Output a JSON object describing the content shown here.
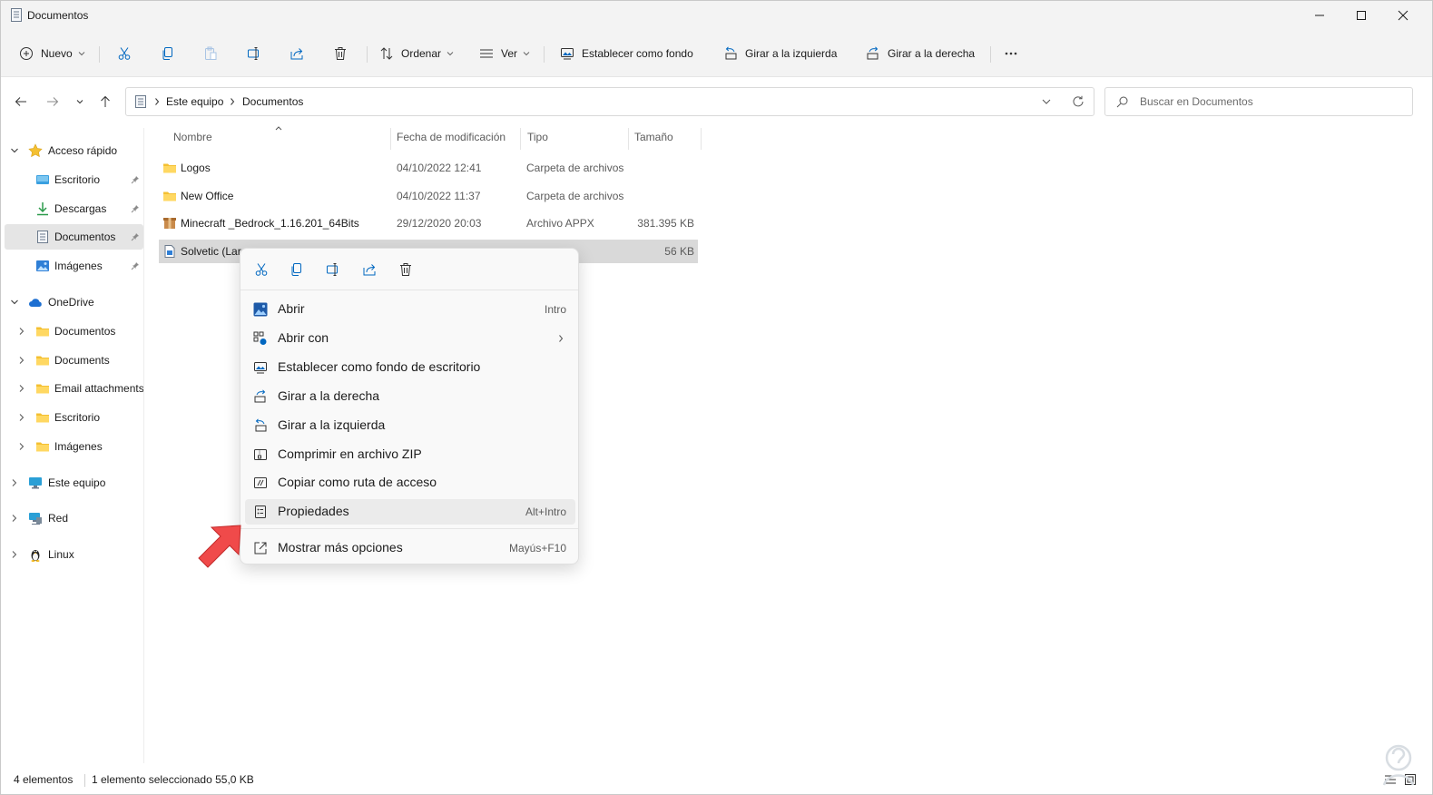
{
  "window": {
    "title": "Documentos"
  },
  "toolbar": {
    "new_label": "Nuevo",
    "sort_label": "Ordenar",
    "view_label": "Ver",
    "set_background_label": "Establecer como fondo",
    "rotate_left_label": "Girar a la izquierda",
    "rotate_right_label": "Girar a la derecha"
  },
  "address": {
    "crumbs": [
      "Este equipo",
      "Documentos"
    ],
    "search_placeholder": "Buscar en Documentos"
  },
  "sidebar": {
    "quick_access": {
      "label": "Acceso rápido",
      "items": [
        {
          "label": "Escritorio",
          "icon": "desktop-icon",
          "pinned": true
        },
        {
          "label": "Descargas",
          "icon": "download-icon",
          "pinned": true
        },
        {
          "label": "Documentos",
          "icon": "document-icon",
          "pinned": true,
          "selected": true
        },
        {
          "label": "Imágenes",
          "icon": "image-icon",
          "pinned": true
        }
      ]
    },
    "onedrive": {
      "label": "OneDrive",
      "items": [
        {
          "label": "Documentos"
        },
        {
          "label": "Documents"
        },
        {
          "label": "Email attachments"
        },
        {
          "label": "Escritorio"
        },
        {
          "label": "Imágenes"
        }
      ]
    },
    "this_pc": {
      "label": "Este equipo"
    },
    "network": {
      "label": "Red"
    },
    "linux": {
      "label": "Linux"
    }
  },
  "filelist": {
    "columns": {
      "name": "Nombre",
      "modified": "Fecha de modificación",
      "type": "Tipo",
      "size": "Tamaño"
    },
    "rows": [
      {
        "name": "Logos",
        "modified": "04/10/2022 12:41",
        "type": "Carpeta de archivos",
        "size": "",
        "icon": "folder-icon"
      },
      {
        "name": "New Office",
        "modified": "04/10/2022 11:37",
        "type": "Carpeta de archivos",
        "size": "",
        "icon": "folder-icon"
      },
      {
        "name": "Minecraft _Bedrock_1.16.201_64Bits",
        "modified": "29/12/2020 20:03",
        "type": "Archivo APPX",
        "size": "381.395 KB",
        "icon": "package-icon"
      },
      {
        "name": "Solvetic (Lar",
        "modified": "",
        "type": "",
        "size": "56 KB",
        "icon": "image-file-icon",
        "selected": true
      }
    ]
  },
  "context_menu": {
    "items": [
      {
        "label": "Abrir",
        "shortcut": "Intro",
        "icon": "photo-app-icon"
      },
      {
        "label": "Abrir con",
        "shortcut": "",
        "icon": "open-with-icon",
        "submenu": true
      },
      {
        "label": "Establecer como fondo de escritorio",
        "shortcut": "",
        "icon": "wallpaper-icon"
      },
      {
        "label": "Girar a la derecha",
        "shortcut": "",
        "icon": "rotate-right-icon"
      },
      {
        "label": "Girar a la izquierda",
        "shortcut": "",
        "icon": "rotate-left-icon"
      },
      {
        "label": "Comprimir en archivo ZIP",
        "shortcut": "",
        "icon": "zip-icon"
      },
      {
        "label": "Copiar como ruta de acceso",
        "shortcut": "",
        "icon": "copy-path-icon"
      },
      {
        "label": "Propiedades",
        "shortcut": "Alt+Intro",
        "icon": "properties-icon",
        "hover": true
      },
      {
        "label": "Mostrar más opciones",
        "shortcut": "Mayús+F10",
        "icon": "more-options-icon"
      }
    ]
  },
  "status": {
    "count": "4 elementos",
    "selection": "1 elemento seleccionado  55,0 KB"
  },
  "colors": {
    "accent": "#0067c0",
    "folder": "#f4c032",
    "arrow": "#f04a4a"
  }
}
